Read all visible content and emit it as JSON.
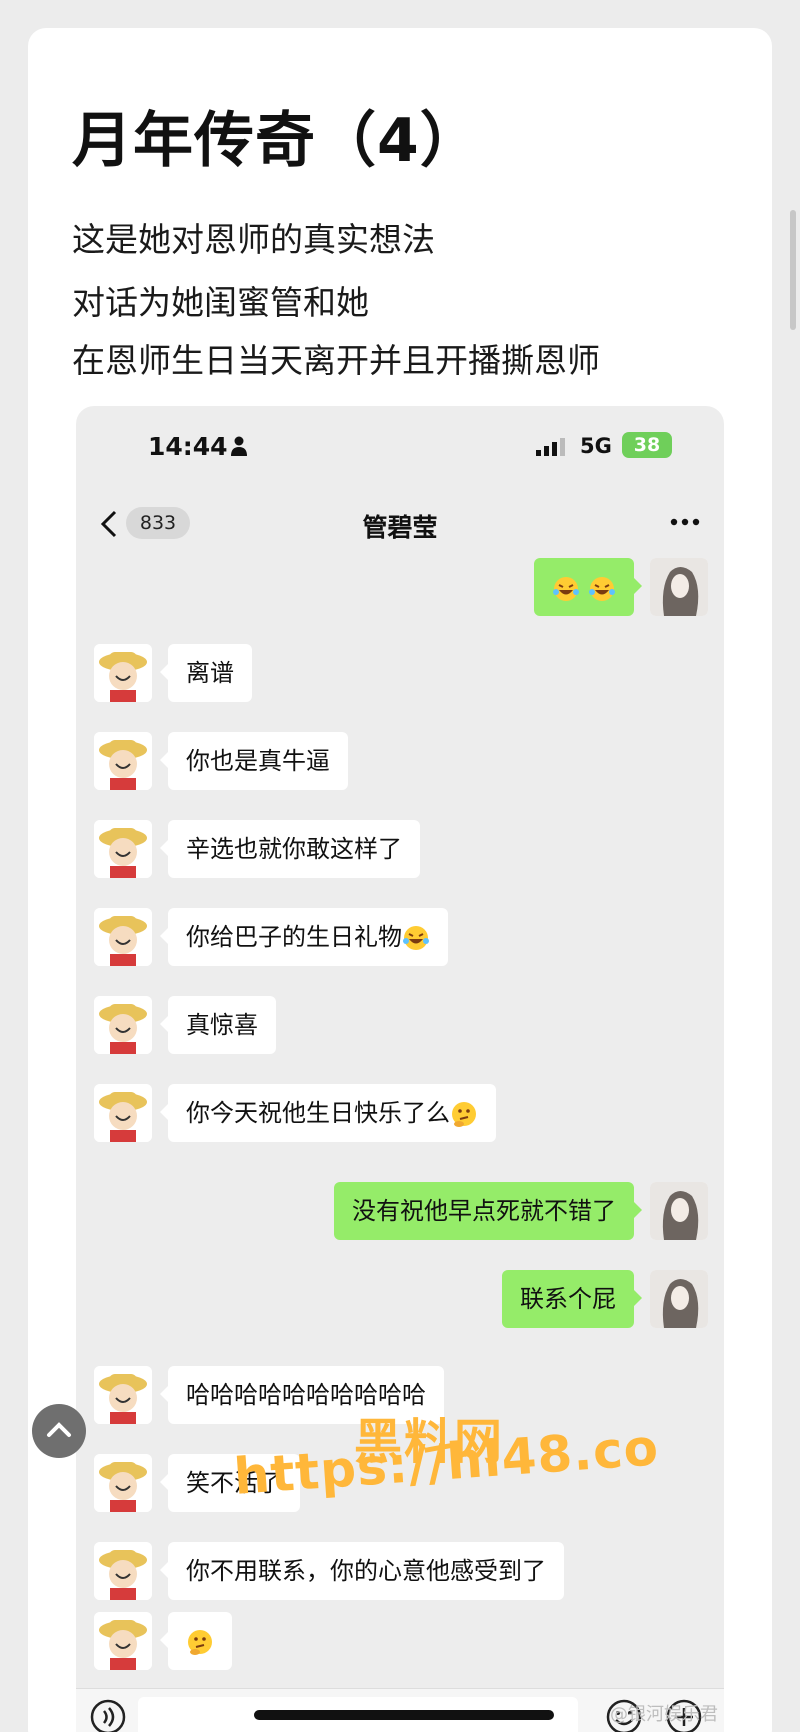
{
  "post": {
    "title": "月年传奇（4）",
    "lines": [
      "这是她对恩师的真实想法",
      "对话为她闺蜜管和她",
      "在恩师生日当天离开并且开播撕恩师"
    ]
  },
  "phone": {
    "time": "14:44",
    "network": "5G",
    "battery": "38",
    "unread_count": "833",
    "chat_title": "管碧莹"
  },
  "messages": [
    {
      "side": "out",
      "text": "",
      "emoji": [
        "laugh-cry",
        "laugh-cry"
      ]
    },
    {
      "side": "in",
      "text": "离谱"
    },
    {
      "side": "in",
      "text": "你也是真牛逼"
    },
    {
      "side": "in",
      "text": "辛选也就你敢这样了"
    },
    {
      "side": "in",
      "text": "你给巴子的生日礼物",
      "emoji": [
        "laugh-cry"
      ]
    },
    {
      "side": "in",
      "text": "真惊喜"
    },
    {
      "side": "in",
      "text": "你今天祝他生日快乐了么",
      "emoji": [
        "thinking"
      ]
    },
    {
      "side": "out",
      "text": "没有祝他早点死就不错了"
    },
    {
      "side": "out",
      "text": "联系个屁"
    },
    {
      "side": "in",
      "text": "哈哈哈哈哈哈哈哈哈哈"
    },
    {
      "side": "in",
      "text": "笑不活了"
    },
    {
      "side": "in",
      "text": "你不用联系，你的心意他感受到了"
    },
    {
      "side": "in",
      "text": "",
      "emoji": [
        "thinking"
      ]
    }
  ],
  "watermark": {
    "cn": "黑料网",
    "url": "https://hl48.co",
    "weibo": "@银河娱乐君"
  },
  "colors": {
    "bubble_out": "#95ec69",
    "bubble_in": "#ffffff",
    "chat_bg": "#ededed",
    "watermark": "#ffb73a",
    "battery": "#6fcf5a"
  },
  "icons": [
    "person-icon",
    "signal-icon",
    "back-icon",
    "more-icon",
    "voice-icon",
    "smile-icon",
    "plus-icon",
    "laugh-cry-emoji",
    "thinking-emoji",
    "scroll-top-icon"
  ]
}
